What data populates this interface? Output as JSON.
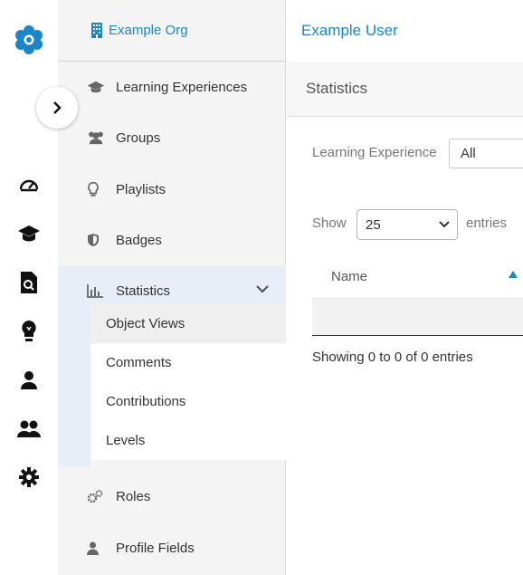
{
  "rail": {
    "icons": [
      "logo-icon",
      "dashboard-icon",
      "graduation-cap-icon",
      "search-file-icon",
      "lightbulb-icon",
      "user-icon",
      "users-icon",
      "gear-icon"
    ]
  },
  "sidebar": {
    "org_name": "Example Org",
    "items": [
      {
        "label": "Learning Experiences",
        "icon": "graduation-cap-icon"
      },
      {
        "label": "Groups",
        "icon": "users-icon"
      },
      {
        "label": "Playlists",
        "icon": "lightbulb-icon"
      },
      {
        "label": "Badges",
        "icon": "shield-icon"
      },
      {
        "label": "Statistics",
        "icon": "bar-chart-icon"
      },
      {
        "label": "Roles",
        "icon": "gears-icon"
      },
      {
        "label": "Profile Fields",
        "icon": "user-icon"
      }
    ],
    "submenu": [
      "Object Views",
      "Comments",
      "Contributions",
      "Levels"
    ]
  },
  "main": {
    "user_name": "Example User",
    "page_title": "Statistics",
    "filter_label": "Learning Experience",
    "filter_value": "All",
    "show_label": "Show",
    "page_size": "25",
    "entries_label": "entries",
    "table": {
      "columns": [
        "Name"
      ]
    },
    "info": "Showing 0 to 0 of 0 entries"
  },
  "colors": {
    "accent": "#1a86c7",
    "active_bg": "#e8eef7"
  }
}
